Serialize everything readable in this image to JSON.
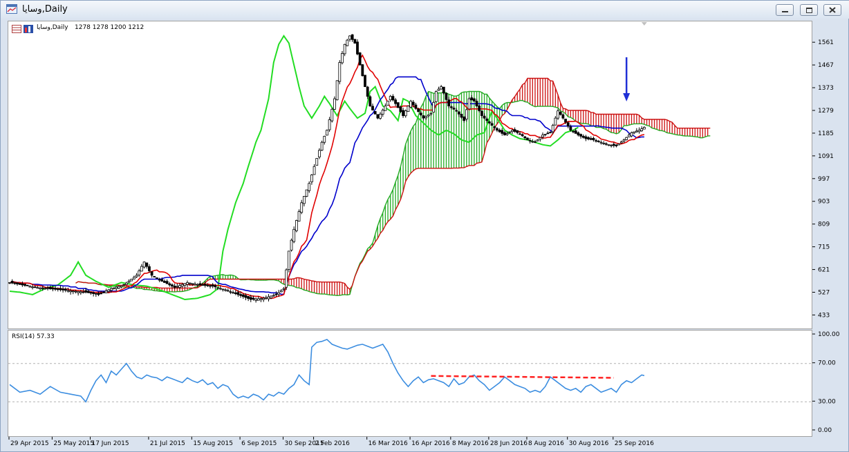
{
  "window": {
    "title": "وسایا,Daily",
    "buttons": [
      "minimize",
      "restore",
      "close"
    ]
  },
  "price_panel": {
    "header_label": "وسایا,Daily",
    "header_values": "1278 1278 1200 1212",
    "icons": [
      "chart-table-icon",
      "bar-chart-icon"
    ]
  },
  "rsi_panel": {
    "label": "RSI(14) 57.33"
  },
  "annotation": {
    "arrow_color": "#1f2fd6",
    "trendline_color": "#ff2020"
  },
  "colors": {
    "tenkan": "#e00000",
    "kijun": "#0000cc",
    "chikou": "#22dd22",
    "cloud_bull": "#22aa22",
    "cloud_bear": "#cc1010",
    "rsi": "#3b8de0",
    "candles": "#000000"
  },
  "chart_data": [
    {
      "type": "candlestick",
      "title": "",
      "series_label": "وسایا,Daily",
      "ylim": [
        380,
        1650
      ],
      "yticks": [
        433,
        527,
        621,
        715,
        809,
        903,
        997,
        1091,
        1185,
        1279,
        1373,
        1467,
        1561
      ],
      "xtick_labels": [
        "29 Apr 2015",
        "25 May 2015",
        "17 Jun 2015",
        "21 Jul 2015",
        "15 Aug 2015",
        "6 Sep 2015",
        "30 Sep 2015",
        "2 Feb 2016",
        "16 Mar 2016",
        "16 Apr 2016",
        "8 May 2016",
        "28 Jun 2016",
        "8 Aug 2016",
        "30 Aug 2016",
        "25 Sep 2016"
      ],
      "grid": false,
      "last_ohlc": {
        "open": 1278,
        "high": 1278,
        "low": 1200,
        "close": 1212
      },
      "close_path": [
        [
          0,
          570
        ],
        [
          10,
          550
        ],
        [
          20,
          540
        ],
        [
          30,
          530
        ],
        [
          35,
          520
        ],
        [
          40,
          545
        ],
        [
          45,
          560
        ],
        [
          50,
          600
        ],
        [
          53,
          655
        ],
        [
          56,
          600
        ],
        [
          60,
          575
        ],
        [
          65,
          550
        ],
        [
          70,
          570
        ],
        [
          75,
          560
        ],
        [
          80,
          555
        ],
        [
          85,
          540
        ],
        [
          90,
          520
        ],
        [
          95,
          500
        ],
        [
          100,
          505
        ],
        [
          105,
          520
        ],
        [
          108,
          545
        ],
        [
          110,
          700
        ],
        [
          112,
          790
        ],
        [
          115,
          900
        ],
        [
          118,
          980
        ],
        [
          120,
          1050
        ],
        [
          123,
          1150
        ],
        [
          125,
          1200
        ],
        [
          128,
          1330
        ],
        [
          130,
          1480
        ],
        [
          132,
          1555
        ],
        [
          134,
          1590
        ],
        [
          136,
          1560
        ],
        [
          138,
          1470
        ],
        [
          140,
          1380
        ],
        [
          142,
          1300
        ],
        [
          145,
          1250
        ],
        [
          148,
          1300
        ],
        [
          150,
          1340
        ],
        [
          152,
          1310
        ],
        [
          155,
          1260
        ],
        [
          158,
          1320
        ],
        [
          160,
          1290
        ],
        [
          163,
          1250
        ],
        [
          166,
          1270
        ],
        [
          168,
          1360
        ],
        [
          170,
          1380
        ],
        [
          173,
          1300
        ],
        [
          176,
          1280
        ],
        [
          179,
          1240
        ],
        [
          181,
          1330
        ],
        [
          183,
          1320
        ],
        [
          186,
          1260
        ],
        [
          189,
          1230
        ],
        [
          192,
          1200
        ],
        [
          195,
          1180
        ],
        [
          198,
          1200
        ],
        [
          201,
          1185
        ],
        [
          204,
          1160
        ],
        [
          207,
          1150
        ],
        [
          210,
          1180
        ],
        [
          213,
          1190
        ],
        [
          216,
          1280
        ],
        [
          218,
          1250
        ],
        [
          221,
          1200
        ],
        [
          224,
          1180
        ],
        [
          227,
          1165
        ],
        [
          230,
          1160
        ],
        [
          233,
          1150
        ],
        [
          236,
          1140
        ],
        [
          239,
          1135
        ],
        [
          242,
          1160
        ],
        [
          245,
          1190
        ],
        [
          248,
          1200
        ],
        [
          250,
          1212
        ]
      ]
    },
    {
      "type": "line",
      "title": "",
      "series": [
        {
          "name": "RSI(14)",
          "last_value": 57.33
        }
      ],
      "ylim": [
        0,
        100
      ],
      "yticks": [
        0,
        30,
        70,
        100
      ],
      "ytick_labels": [
        "0.00",
        "30.00",
        "70.00",
        "100.00"
      ],
      "levels": [
        30,
        70
      ],
      "points": [
        [
          0,
          48
        ],
        [
          4,
          40
        ],
        [
          8,
          42
        ],
        [
          12,
          38
        ],
        [
          16,
          46
        ],
        [
          20,
          40
        ],
        [
          24,
          38
        ],
        [
          28,
          36
        ],
        [
          30,
          30
        ],
        [
          32,
          42
        ],
        [
          34,
          52
        ],
        [
          36,
          58
        ],
        [
          38,
          50
        ],
        [
          40,
          62
        ],
        [
          42,
          58
        ],
        [
          44,
          64
        ],
        [
          46,
          70
        ],
        [
          48,
          62
        ],
        [
          50,
          56
        ],
        [
          52,
          54
        ],
        [
          54,
          58
        ],
        [
          56,
          56
        ],
        [
          58,
          55
        ],
        [
          60,
          52
        ],
        [
          62,
          56
        ],
        [
          64,
          54
        ],
        [
          66,
          52
        ],
        [
          68,
          50
        ],
        [
          70,
          55
        ],
        [
          72,
          52
        ],
        [
          74,
          50
        ],
        [
          76,
          53
        ],
        [
          78,
          48
        ],
        [
          80,
          50
        ],
        [
          82,
          44
        ],
        [
          84,
          48
        ],
        [
          86,
          46
        ],
        [
          88,
          38
        ],
        [
          90,
          34
        ],
        [
          92,
          36
        ],
        [
          94,
          34
        ],
        [
          96,
          38
        ],
        [
          98,
          36
        ],
        [
          100,
          32
        ],
        [
          102,
          38
        ],
        [
          104,
          36
        ],
        [
          106,
          40
        ],
        [
          108,
          38
        ],
        [
          110,
          44
        ],
        [
          112,
          48
        ],
        [
          114,
          58
        ],
        [
          116,
          52
        ],
        [
          118,
          48
        ],
        [
          119,
          87
        ],
        [
          121,
          92
        ],
        [
          123,
          93
        ],
        [
          125,
          95
        ],
        [
          127,
          90
        ],
        [
          129,
          88
        ],
        [
          131,
          86
        ],
        [
          133,
          85
        ],
        [
          135,
          87
        ],
        [
          137,
          89
        ],
        [
          139,
          90
        ],
        [
          141,
          88
        ],
        [
          143,
          86
        ],
        [
          145,
          88
        ],
        [
          147,
          90
        ],
        [
          149,
          82
        ],
        [
          151,
          70
        ],
        [
          153,
          60
        ],
        [
          155,
          52
        ],
        [
          157,
          46
        ],
        [
          159,
          52
        ],
        [
          161,
          56
        ],
        [
          163,
          50
        ],
        [
          165,
          53
        ],
        [
          167,
          54
        ],
        [
          169,
          52
        ],
        [
          171,
          50
        ],
        [
          173,
          46
        ],
        [
          175,
          54
        ],
        [
          177,
          48
        ],
        [
          179,
          50
        ],
        [
          181,
          56
        ],
        [
          183,
          58
        ],
        [
          185,
          52
        ],
        [
          187,
          48
        ],
        [
          189,
          42
        ],
        [
          191,
          46
        ],
        [
          193,
          50
        ],
        [
          195,
          56
        ],
        [
          197,
          52
        ],
        [
          199,
          48
        ],
        [
          201,
          46
        ],
        [
          203,
          44
        ],
        [
          205,
          40
        ],
        [
          207,
          42
        ],
        [
          209,
          40
        ],
        [
          211,
          46
        ],
        [
          213,
          56
        ],
        [
          215,
          52
        ],
        [
          217,
          48
        ],
        [
          219,
          44
        ],
        [
          221,
          42
        ],
        [
          223,
          44
        ],
        [
          225,
          40
        ],
        [
          227,
          46
        ],
        [
          229,
          48
        ],
        [
          231,
          44
        ],
        [
          233,
          40
        ],
        [
          235,
          42
        ],
        [
          237,
          44
        ],
        [
          239,
          40
        ],
        [
          241,
          48
        ],
        [
          243,
          52
        ],
        [
          245,
          50
        ],
        [
          247,
          54
        ],
        [
          249,
          58
        ],
        [
          250,
          57.33
        ]
      ],
      "trendline": [
        [
          166,
          57
        ],
        [
          238,
          55
        ]
      ]
    }
  ]
}
